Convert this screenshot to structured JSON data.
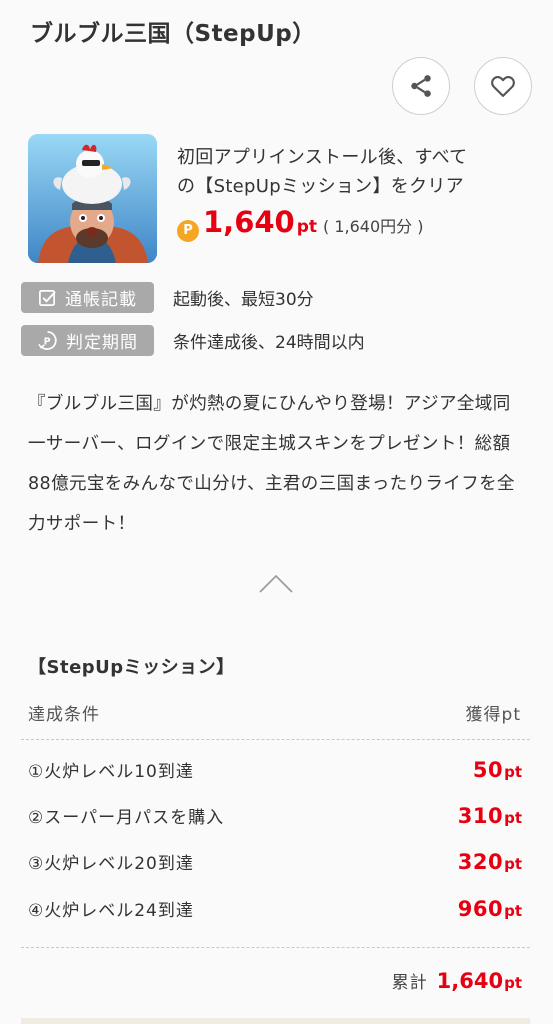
{
  "app": {
    "title": "ブルブル三国（StepUp）"
  },
  "actions": {
    "share_icon": "share-icon",
    "favorite_icon": "heart-icon"
  },
  "offer": {
    "description_line1": "初回アプリインストール後、すべて",
    "description_line2": "の【StepUpミッション】をクリア",
    "point_badge": "P",
    "points": "1,640",
    "points_unit": "pt",
    "yen_equivalent": "( 1,640円分 )",
    "accent_color": "#e60012",
    "badge_color": "#f5a623"
  },
  "info_tags": [
    {
      "label": "通帳記載",
      "value": "起動後、最短30分",
      "icon": "checkbox-icon"
    },
    {
      "label": "判定期間",
      "value": "条件達成後、24時間以内",
      "icon": "clock-p-icon"
    }
  ],
  "description": {
    "text": "『ブルブル三国』が灼熱の夏にひんやり登場！アジア全域同一サーバー、ログインで限定主城スキンをプレゼント！総額88億元宝をみんなで山分け、主君の三国まったりライフを全力サポート！"
  },
  "missions": {
    "section_title": "【StepUpミッション】",
    "header_condition": "達成条件",
    "header_points": "獲得pt",
    "items": [
      {
        "label": "①火炉レベル10到達",
        "points": "50",
        "unit": "pt"
      },
      {
        "label": "②スーパー月パスを購入",
        "points": "310",
        "unit": "pt"
      },
      {
        "label": "③火炉レベル20到達",
        "points": "320",
        "unit": "pt"
      },
      {
        "label": "④火炉レベル24到達",
        "points": "960",
        "unit": "pt"
      }
    ],
    "total_label": "累計",
    "total_points": "1,640",
    "total_unit": "pt"
  }
}
